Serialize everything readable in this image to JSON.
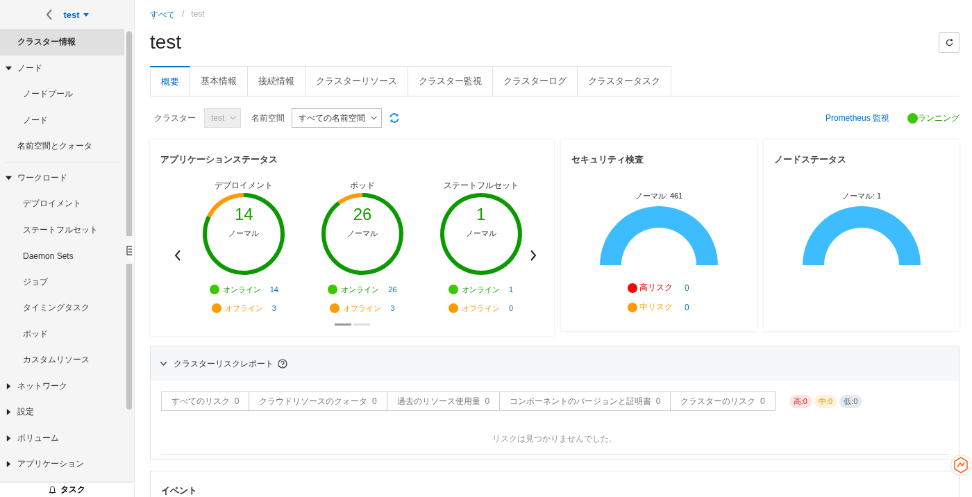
{
  "sidebar": {
    "cluster": "test",
    "items": [
      {
        "kind": "item",
        "label": "クラスター情報",
        "selected": true
      },
      {
        "kind": "group",
        "label": "ノード",
        "expanded": true,
        "children": [
          {
            "label": "ノードプール",
            "selected": false
          },
          {
            "label": "ノード",
            "selected": false
          }
        ]
      },
      {
        "kind": "item",
        "label": "名前空間とクォータ",
        "selected": false
      },
      {
        "kind": "divider"
      },
      {
        "kind": "group",
        "label": "ワークロード",
        "expanded": true,
        "children": [
          {
            "label": "デプロイメント",
            "selected": false
          },
          {
            "label": "ステートフルセット",
            "selected": false
          },
          {
            "label": "Daemon Sets",
            "selected": false
          },
          {
            "label": "ジョブ",
            "selected": false
          },
          {
            "label": "タイミングタスク",
            "selected": false
          },
          {
            "label": "ポッド",
            "selected": false
          },
          {
            "label": "カスタムリソース",
            "selected": false
          }
        ]
      },
      {
        "kind": "group",
        "label": "ネットワーク",
        "expanded": false
      },
      {
        "kind": "group",
        "label": "設定",
        "expanded": false
      },
      {
        "kind": "group",
        "label": "ボリューム",
        "expanded": false
      },
      {
        "kind": "group",
        "label": "アプリケーション",
        "expanded": false
      }
    ],
    "task_button": "タスク"
  },
  "breadcrumb": {
    "items": [
      {
        "label": "すべて",
        "link": true
      },
      {
        "label": "test",
        "link": false
      }
    ],
    "separator": "/"
  },
  "title": "test",
  "tabs": [
    {
      "label": "概要",
      "selected": true
    },
    {
      "label": "基本情報",
      "selected": false
    },
    {
      "label": "接続情報",
      "selected": false
    },
    {
      "label": "クラスターリソース",
      "selected": false
    },
    {
      "label": "クラスター監視",
      "selected": false
    },
    {
      "label": "クラスターログ",
      "selected": false
    },
    {
      "label": "クラスタータスク",
      "selected": false
    }
  ],
  "filters": {
    "cluster_label": "クラスター",
    "cluster_value": "test",
    "cluster_disabled": true,
    "namespace_label": "名前空間",
    "namespace_value": "すべての名前空間"
  },
  "prometheus_link": "Prometheus 監視",
  "status": "ランニング",
  "app_status": {
    "title": "アプリケーションステータス",
    "workloads": [
      {
        "name": "デプロイメント",
        "total": "14",
        "total_label": "ノーマル",
        "online_label": "オンライン",
        "online": "14",
        "offline_label": "オフライン",
        "offline": "3"
      },
      {
        "name": "ポッド",
        "total": "26",
        "total_label": "ノーマル",
        "online_label": "オンライン",
        "online": "26",
        "offline_label": "オフライン",
        "offline": "3"
      },
      {
        "name": "ステートフルセット",
        "total": "1",
        "total_label": "ノーマル",
        "online_label": "オンライン",
        "online": "1",
        "offline_label": "オフライン",
        "offline": "0"
      }
    ],
    "pages": [
      {
        "selected": true
      },
      {
        "selected": false
      }
    ]
  },
  "security": {
    "title": "セキュリティ検査",
    "summary": "ノーマル: 461",
    "risks": [
      {
        "label": "高リスク",
        "count": "0",
        "color": "#ff0000"
      },
      {
        "label": "中リスク",
        "count": "0",
        "color": "#ff9900"
      }
    ]
  },
  "node_status": {
    "title": "ノードステータス",
    "summary": "ノーマル: 1"
  },
  "risk_report": {
    "title": "クラスターリスクレポート",
    "expanded": true,
    "filters": [
      {
        "label": "すべてのリスク",
        "count": "0"
      },
      {
        "label": "クラウドリソースのクォータ",
        "count": "0"
      },
      {
        "label": "過去のリソース使用量",
        "count": "0"
      },
      {
        "label": "コンポーネントのバージョンと証明書",
        "count": "0"
      },
      {
        "label": "クラスターのリスク",
        "count": "0"
      }
    ],
    "levels": [
      {
        "label": "高:0",
        "kind": "high"
      },
      {
        "label": "中:0",
        "kind": "medium"
      },
      {
        "label": "低:0",
        "kind": "low"
      }
    ],
    "empty_text": "リスクは見つかりませんでした。"
  },
  "events": {
    "title": "イベント"
  }
}
